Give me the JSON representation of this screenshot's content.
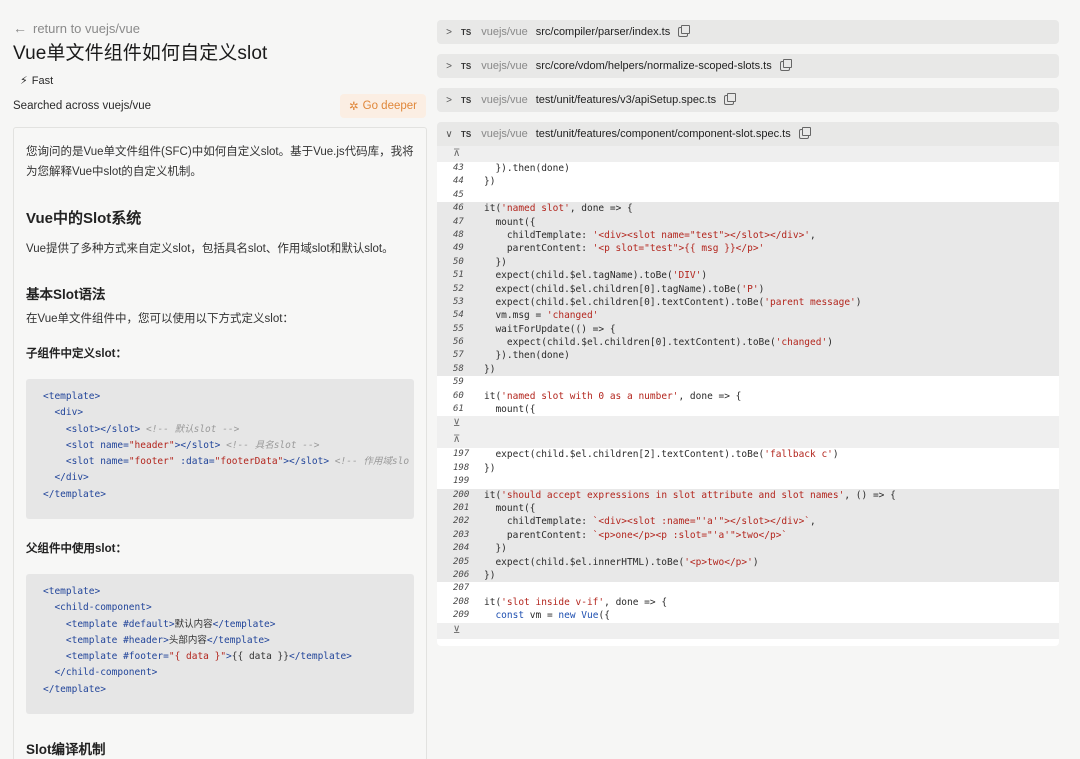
{
  "back_link": "return to vuejs/vue",
  "title": "Vue单文件组件如何自定义slot",
  "mode": "Fast",
  "searched": "Searched across vuejs/vue",
  "go_deeper": "Go deeper",
  "answer": {
    "intro1": "您询问的是Vue单文件组件(SFC)中如何自定义slot。基于Vue.js代码库，我将",
    "intro2": "为您解释Vue中slot的自定义机制。",
    "h_system": "Vue中的Slot系统",
    "p_system": "Vue提供了多种方式来自定义slot，包括具名slot、作用域slot和默认slot。",
    "h_syntax": "基本Slot语法",
    "p_syntax": "在Vue单文件组件中，您可以使用以下方式定义slot：",
    "h_child": "子组件中定义slot：",
    "h_parent": "父组件中使用slot：",
    "h_compile": "Slot编译机制"
  },
  "code_child": [
    "<template>",
    "  <div>",
    "    <slot></slot> <!-- 默认slot -->",
    "    <slot name=\"header\"></slot> <!-- 具名slot -->",
    "    <slot name=\"footer\" :data=\"footerData\"></slot> <!-- 作用域slo",
    "  </div>",
    "</template>"
  ],
  "code_parent": [
    "<template>",
    "  <child-component>",
    "    <template #default>默认内容</template>",
    "    <template #header>头部内容</template>",
    "    <template #footer=\"{ data }\">{{ data }}</template>",
    "  </child-component>",
    "</template>"
  ],
  "files": [
    {
      "lang": "TS",
      "repo": "vuejs/vue",
      "path": "src/compiler/parser/index.ts",
      "expanded": false
    },
    {
      "lang": "TS",
      "repo": "vuejs/vue",
      "path": "src/core/vdom/helpers/normalize-scoped-slots.ts",
      "expanded": false
    },
    {
      "lang": "TS",
      "repo": "vuejs/vue",
      "path": "test/unit/features/v3/apiSetup.spec.ts",
      "expanded": false
    },
    {
      "lang": "TS",
      "repo": "vuejs/vue",
      "path": "test/unit/features/component/component-slot.spec.ts",
      "expanded": true
    }
  ],
  "chevrons": {
    "collapsed": ">",
    "expanded": "∨"
  },
  "expand_up": "⊼",
  "expand_down": "⊻",
  "code_blocks": [
    {
      "lines": [
        {
          "n": "43",
          "code": "  }).then(done)",
          "hl": false
        },
        {
          "n": "44",
          "code": "})",
          "hl": false
        },
        {
          "n": "45",
          "code": "",
          "hl": false
        },
        {
          "n": "46",
          "code": "it('named slot', done => {",
          "hl": true
        },
        {
          "n": "47",
          "code": "  mount({",
          "hl": true
        },
        {
          "n": "48",
          "code": "    childTemplate: '<div><slot name=\"test\"></slot></div>',",
          "hl": true
        },
        {
          "n": "49",
          "code": "    parentContent: '<p slot=\"test\">{{ msg }}</p>'",
          "hl": true
        },
        {
          "n": "50",
          "code": "  })",
          "hl": true
        },
        {
          "n": "51",
          "code": "  expect(child.$el.tagName).toBe('DIV')",
          "hl": true
        },
        {
          "n": "52",
          "code": "  expect(child.$el.children[0].tagName).toBe('P')",
          "hl": true
        },
        {
          "n": "53",
          "code": "  expect(child.$el.children[0].textContent).toBe('parent message')",
          "hl": true
        },
        {
          "n": "54",
          "code": "  vm.msg = 'changed'",
          "hl": true
        },
        {
          "n": "55",
          "code": "  waitForUpdate(() => {",
          "hl": true
        },
        {
          "n": "56",
          "code": "    expect(child.$el.children[0].textContent).toBe('changed')",
          "hl": true
        },
        {
          "n": "57",
          "code": "  }).then(done)",
          "hl": true
        },
        {
          "n": "58",
          "code": "})",
          "hl": true
        },
        {
          "n": "59",
          "code": "",
          "hl": false
        },
        {
          "n": "60",
          "code": "it('named slot with 0 as a number', done => {",
          "hl": false
        },
        {
          "n": "61",
          "code": "  mount({",
          "hl": false
        }
      ]
    },
    {
      "lines": [
        {
          "n": "197",
          "code": "  expect(child.$el.children[2].textContent).toBe('fallback c')",
          "hl": false
        },
        {
          "n": "198",
          "code": "})",
          "hl": false
        },
        {
          "n": "199",
          "code": "",
          "hl": false
        },
        {
          "n": "200",
          "code": "it('should accept expressions in slot attribute and slot names', () => {",
          "hl": true
        },
        {
          "n": "201",
          "code": "  mount({",
          "hl": true
        },
        {
          "n": "202",
          "code": "    childTemplate: `<div><slot :name=\"'a'\"></slot></div>`,",
          "hl": true
        },
        {
          "n": "203",
          "code": "    parentContent: `<p>one</p><p :slot=\"'a'\">two</p>`",
          "hl": true
        },
        {
          "n": "204",
          "code": "  })",
          "hl": true
        },
        {
          "n": "205",
          "code": "  expect(child.$el.innerHTML).toBe('<p>two</p>')",
          "hl": true
        },
        {
          "n": "206",
          "code": "})",
          "hl": true
        },
        {
          "n": "207",
          "code": "",
          "hl": false
        },
        {
          "n": "208",
          "code": "it('slot inside v-if', done => {",
          "hl": false
        },
        {
          "n": "209",
          "code": "  const vm = new Vue({",
          "hl": false
        }
      ]
    }
  ]
}
